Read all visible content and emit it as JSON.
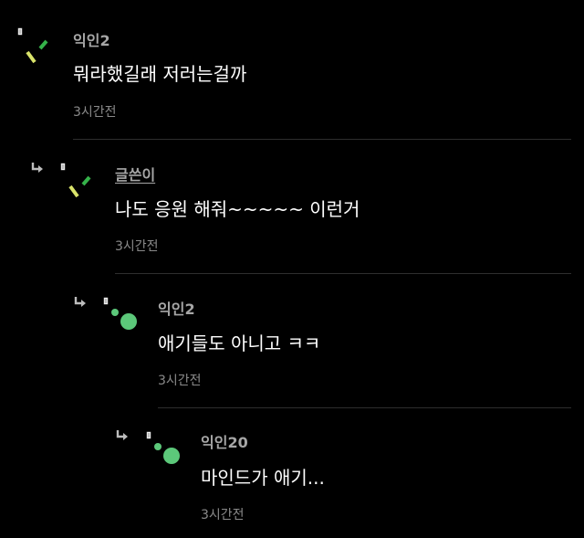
{
  "comments": [
    {
      "author": "익인2",
      "is_op": false,
      "text": "뭐라했길래 저러는걸까",
      "time": "3시간전",
      "avatar_icon": "confetti-icon",
      "is_reply": false
    },
    {
      "author": "글쓴이",
      "is_op": true,
      "text": "나도 응원 해줘~~~~~ 이런거",
      "time": "3시간전",
      "avatar_icon": "confetti-icon",
      "is_reply": true
    },
    {
      "author": "익인2",
      "is_op": false,
      "text": "애기들도 아니고 ㅋㅋ",
      "time": "3시간전",
      "avatar_icon": "green-dots-icon",
      "is_reply": true
    },
    {
      "author": "익인20",
      "is_op": false,
      "text": "마인드가 애기...",
      "time": "3시간전",
      "avatar_icon": "green-dots-icon",
      "is_reply": true
    }
  ],
  "colors": {
    "background": "#000000",
    "author": "#a6a6a6",
    "text": "#ffffff",
    "time": "#8a8a8a",
    "divider": "#2e2e2e",
    "confetti_yellow": "#d9e36a",
    "confetti_green": "#35b24a",
    "dot_green": "#5cc87a"
  }
}
